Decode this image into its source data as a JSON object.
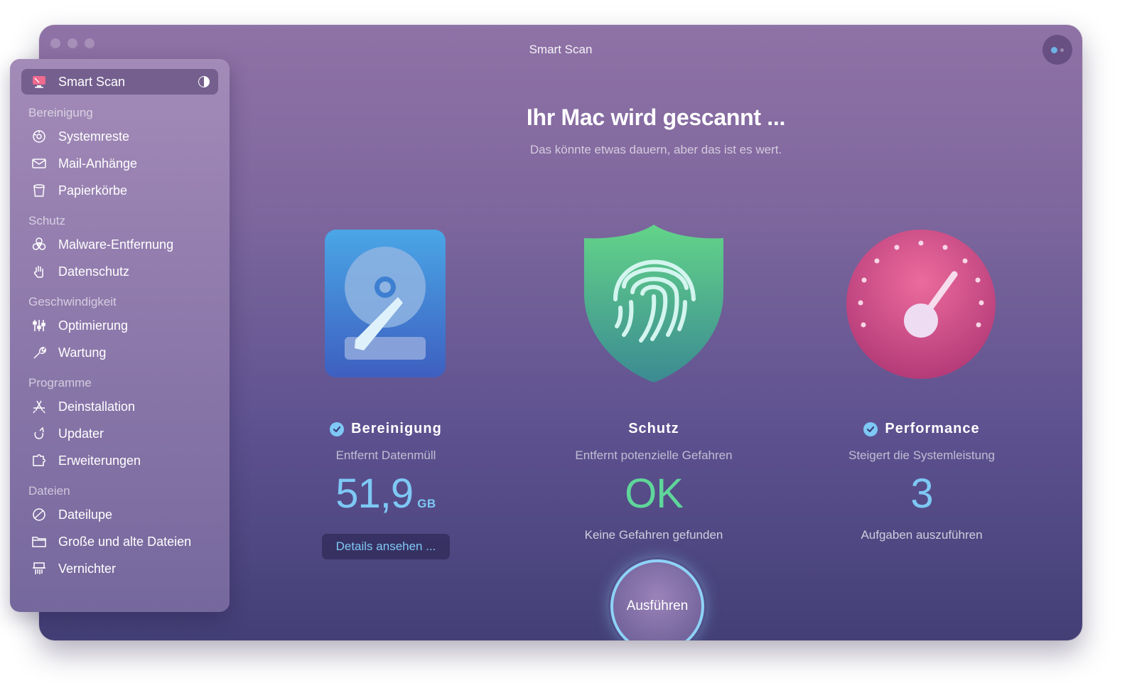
{
  "window": {
    "title": "Smart Scan"
  },
  "sidebar": {
    "active": {
      "label": "Smart Scan"
    },
    "groups": [
      {
        "label": "Bereinigung",
        "items": [
          {
            "label": "Systemreste"
          },
          {
            "label": "Mail-Anhänge"
          },
          {
            "label": "Papierkörbe"
          }
        ]
      },
      {
        "label": "Schutz",
        "items": [
          {
            "label": "Malware-Entfernung"
          },
          {
            "label": "Datenschutz"
          }
        ]
      },
      {
        "label": "Geschwindigkeit",
        "items": [
          {
            "label": "Optimierung"
          },
          {
            "label": "Wartung"
          }
        ]
      },
      {
        "label": "Programme",
        "items": [
          {
            "label": "Deinstallation"
          },
          {
            "label": "Updater"
          },
          {
            "label": "Erweiterungen"
          }
        ]
      },
      {
        "label": "Dateien",
        "items": [
          {
            "label": "Dateilupe"
          },
          {
            "label": "Große und alte Dateien"
          },
          {
            "label": "Vernichter"
          }
        ]
      }
    ]
  },
  "main": {
    "headline": "Ihr Mac wird gescannt ...",
    "subline": "Das könnte etwas dauern, aber das ist es wert.",
    "modules": [
      {
        "title": "Bereinigung",
        "subtitle": "Entfernt Datenmüll",
        "value": "51,9",
        "unit": "GB",
        "action": "Details ansehen ..."
      },
      {
        "title": "Schutz",
        "subtitle": "Entfernt potenzielle Gefahren",
        "value": "OK",
        "note": "Keine Gefahren gefunden"
      },
      {
        "title": "Performance",
        "subtitle": "Steigert die Systemleistung",
        "value": "3",
        "note": "Aufgaben auszuführen"
      }
    ],
    "run_button": "Ausführen"
  },
  "colors": {
    "accent_blue": "#7ec8f5",
    "accent_green": "#5fd69a",
    "active_item_bg": "#5a4a7a"
  }
}
